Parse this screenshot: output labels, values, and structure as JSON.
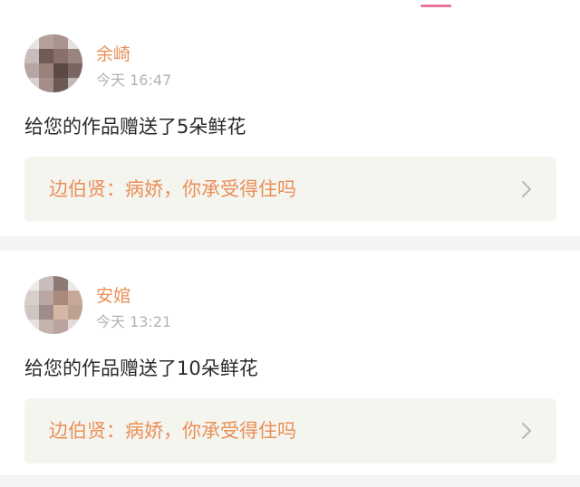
{
  "accent_color": "#e98f57",
  "notifications": [
    {
      "user_name": "余崎",
      "time": "今天 16:47",
      "message": "给您的作品赠送了5朵鲜花",
      "work_title": "边伯贤：病娇，你承受得住吗",
      "avatar_icon": "user-avatar-icon",
      "link_icon": "chevron-right-icon"
    },
    {
      "user_name": "安婠",
      "time": "今天 13:21",
      "message": "给您的作品赠送了10朵鲜花",
      "work_title": "边伯贤：病娇，你承受得住吗",
      "avatar_icon": "user-avatar-icon",
      "link_icon": "chevron-right-icon"
    }
  ]
}
